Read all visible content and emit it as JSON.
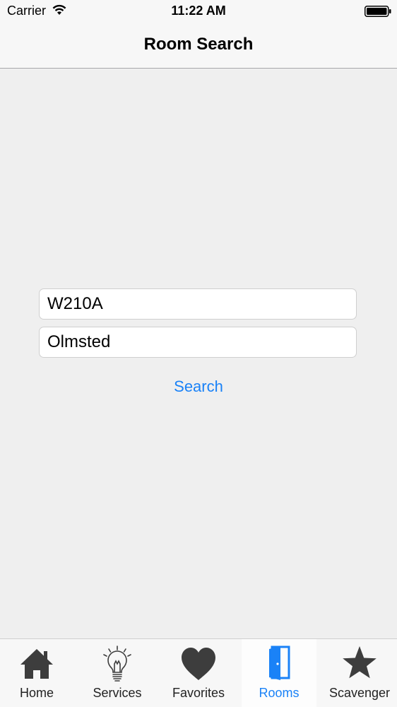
{
  "status_bar": {
    "carrier": "Carrier",
    "time": "11:22 AM"
  },
  "nav": {
    "title": "Room Search"
  },
  "form": {
    "room_value": "W210A",
    "building_value": "Olmsted",
    "search_label": "Search"
  },
  "tabs": [
    {
      "label": "Home",
      "icon": "home-icon"
    },
    {
      "label": "Services",
      "icon": "lightbulb-icon"
    },
    {
      "label": "Favorites",
      "icon": "heart-icon"
    },
    {
      "label": "Rooms",
      "icon": "door-icon",
      "selected": true
    },
    {
      "label": "Scavenger",
      "icon": "star-icon"
    }
  ],
  "colors": {
    "accent": "#1a82f7",
    "background": "#efefef",
    "bar_background": "#f7f7f7",
    "tab_icon": "#3d3d3d"
  }
}
